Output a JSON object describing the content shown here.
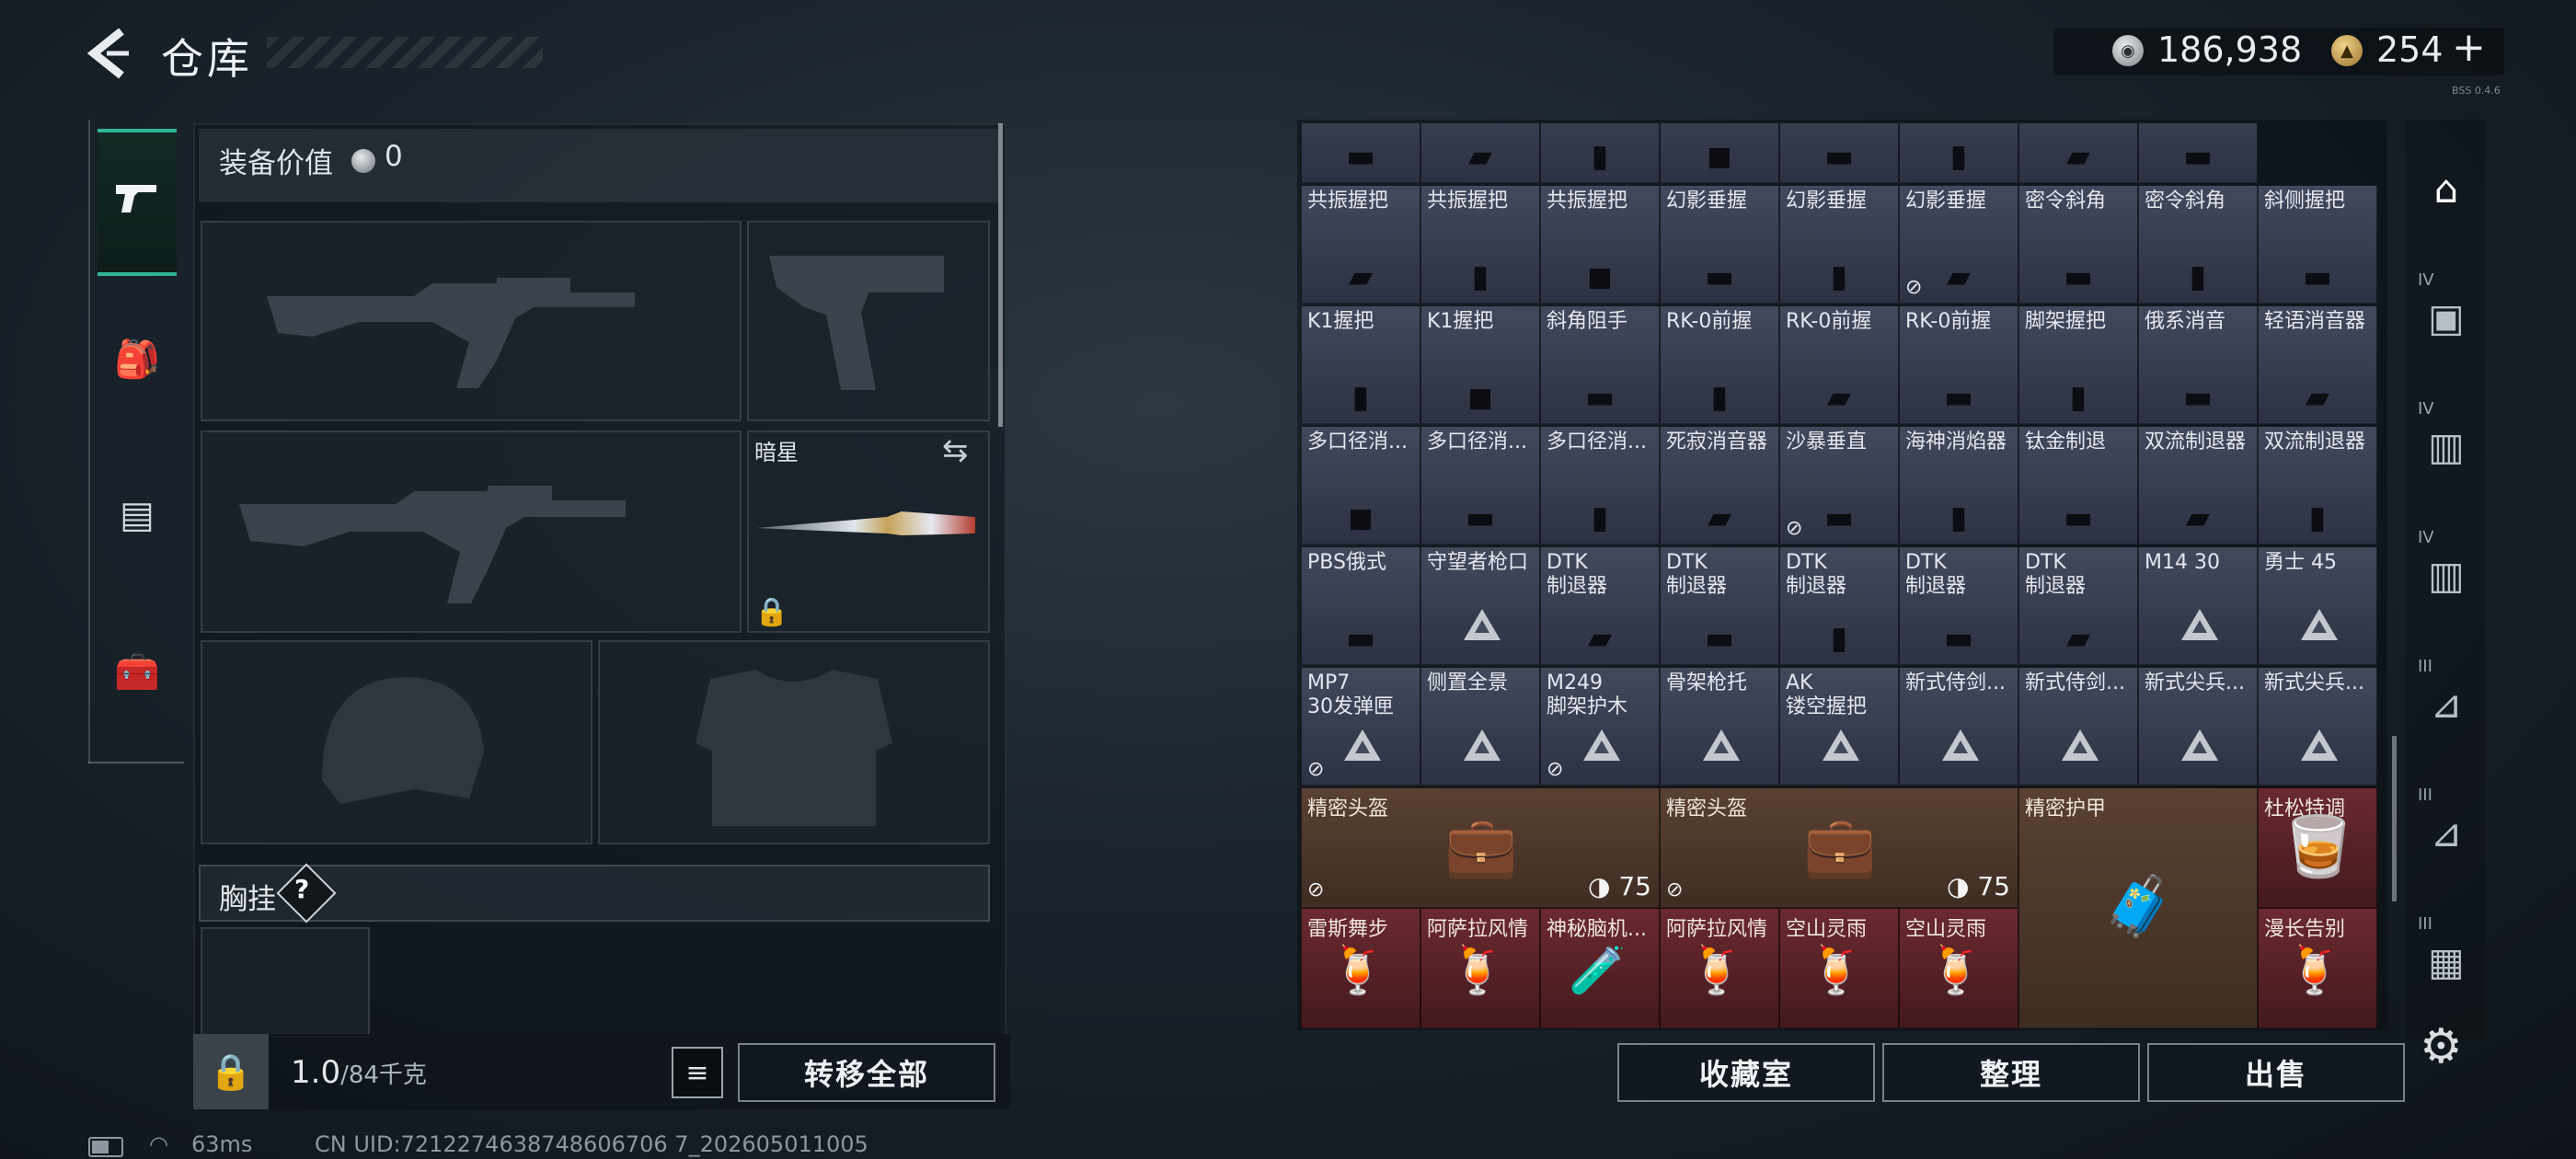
{
  "header": {
    "title": "仓库",
    "currency_silver": "186,938",
    "currency_gold": "254",
    "currency_plus": "+",
    "version_tiny": "BSS 0.4.6"
  },
  "left_rail": {
    "tabs": [
      "pistol-icon",
      "backpack-armor-icon",
      "backpack-icon",
      "toolbox-icon"
    ],
    "active_tab": 0
  },
  "equip": {
    "label": "装备价值",
    "value": "0"
  },
  "knife": {
    "name": "暗星"
  },
  "chest": {
    "label": "胸挂",
    "help": "?"
  },
  "bottom_left": {
    "weight": "1.0",
    "weight_max": "/84千克",
    "transfer_all": "转移全部"
  },
  "status_bar": {
    "ping": "63ms",
    "uid": "CN UID:7212274638748606706 7_202605011005"
  },
  "stash": {
    "rows": [
      [
        {
          "name": ""
        },
        {
          "name": ""
        },
        {
          "name": ""
        },
        {
          "name": ""
        },
        {
          "name": ""
        },
        {
          "name": ""
        },
        {
          "name": ""
        },
        {
          "name": ""
        }
      ],
      [
        {
          "name": "共振握把"
        },
        {
          "name": "共振握把"
        },
        {
          "name": "共振握把"
        },
        {
          "name": "幻影垂握"
        },
        {
          "name": "幻影垂握"
        },
        {
          "name": "幻影垂握",
          "mark": "⊘"
        },
        {
          "name": "密令斜角"
        },
        {
          "name": "密令斜角"
        },
        {
          "name": "斜侧握把"
        }
      ],
      [
        {
          "name": "K1握把"
        },
        {
          "name": "K1握把"
        },
        {
          "name": "斜角阻手"
        },
        {
          "name": "RK-0前握"
        },
        {
          "name": "RK-0前握"
        },
        {
          "name": "RK-0前握"
        },
        {
          "name": "脚架握把"
        },
        {
          "name": "俄系消音"
        },
        {
          "name": "轻语消音器"
        }
      ],
      [
        {
          "name": "多口径消..."
        },
        {
          "name": "多口径消..."
        },
        {
          "name": "多口径消..."
        },
        {
          "name": "死寂消音器"
        },
        {
          "name": "沙暴垂直",
          "mark": "⊘"
        },
        {
          "name": "海神消焰器"
        },
        {
          "name": "钛金制退"
        },
        {
          "name": "双流制退器"
        },
        {
          "name": "双流制退器"
        }
      ],
      [
        {
          "name": "PBS俄式"
        },
        {
          "name": "守望者枪口",
          "tri": true
        },
        {
          "name": "DTK\n制退器"
        },
        {
          "name": "DTK\n制退器"
        },
        {
          "name": "DTK\n制退器"
        },
        {
          "name": "DTK\n制退器"
        },
        {
          "name": "DTK\n制退器"
        },
        {
          "name": "M14 30",
          "tri": true
        },
        {
          "name": "勇士 45",
          "tri": true
        }
      ],
      [
        {
          "name": "MP7\n30发弹匣",
          "tri": true,
          "mark": "⊘"
        },
        {
          "name": "侧置全景",
          "tri": true
        },
        {
          "name": "M249\n脚架护木",
          "tri": true,
          "mark": "⊘"
        },
        {
          "name": "骨架枪托",
          "tri": true
        },
        {
          "name": "AK\n镂空握把",
          "tri": true
        },
        {
          "name": "新式侍剑...",
          "tri": true
        },
        {
          "name": "新式侍剑...",
          "tri": true
        },
        {
          "name": "新式尖兵...",
          "tri": true
        },
        {
          "name": "新式尖兵...",
          "tri": true
        }
      ]
    ],
    "large_items": [
      {
        "name": "精密头盔",
        "armor": "75",
        "mark": "⊘"
      },
      {
        "name": "精密头盔",
        "armor": "75",
        "mark": "⊘"
      },
      {
        "name": "精密护甲"
      },
      {
        "name": "杜松特调"
      }
    ],
    "last_row": [
      {
        "name": "雷斯舞步"
      },
      {
        "name": "阿萨拉风情"
      },
      {
        "name": "神秘脑机..."
      },
      {
        "name": "阿萨拉风情"
      },
      {
        "name": "空山灵雨"
      },
      {
        "name": "空山灵雨"
      },
      {
        "name": "漫长告别"
      }
    ]
  },
  "actions": {
    "collection": "收藏室",
    "organize": "整理",
    "sell": "出售"
  },
  "right_rail": {
    "levels": [
      "",
      "IV",
      "IV",
      "IV",
      "III",
      "III",
      "III"
    ]
  }
}
